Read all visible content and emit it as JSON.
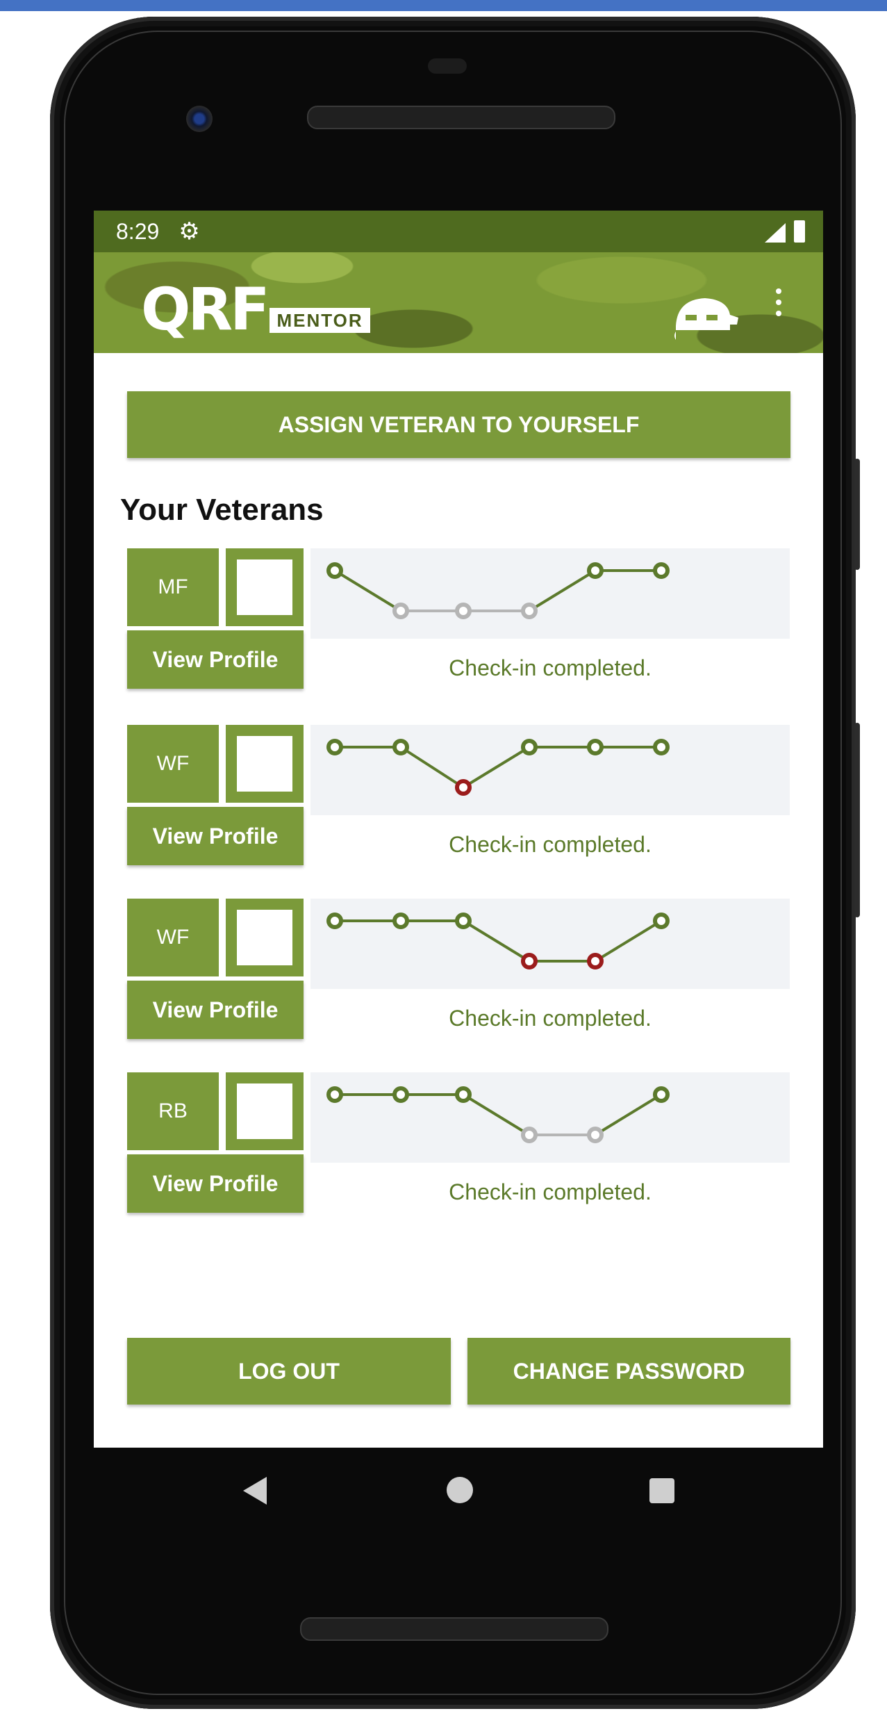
{
  "status_bar": {
    "time": "8:29",
    "gear_icon": "⚙"
  },
  "app_bar": {
    "logo_main": "QRF",
    "logo_sub": "MENTOR"
  },
  "assign_button": "ASSIGN VETERAN TO YOURSELF",
  "section_title": "Your Veterans",
  "veterans": [
    {
      "initials": "MF",
      "view_profile": "View Profile",
      "status": "Check-in completed.",
      "trend": [
        2,
        1,
        1,
        1,
        2,
        2
      ],
      "point_states": [
        "good",
        "neutral",
        "neutral",
        "neutral",
        "good",
        "good"
      ]
    },
    {
      "initials": "WF",
      "view_profile": "View Profile",
      "status": "Check-in completed.",
      "trend": [
        2,
        2,
        1,
        2,
        2,
        2
      ],
      "point_states": [
        "good",
        "good",
        "bad",
        "good",
        "good",
        "good"
      ]
    },
    {
      "initials": "WF",
      "view_profile": "View Profile",
      "status": "Check-in completed.",
      "trend": [
        2,
        2,
        2,
        1,
        1,
        2
      ],
      "point_states": [
        "good",
        "good",
        "good",
        "bad",
        "bad",
        "good"
      ]
    },
    {
      "initials": "RB",
      "view_profile": "View Profile",
      "status": "Check-in completed.",
      "trend": [
        2,
        2,
        2,
        1,
        1,
        2
      ],
      "point_states": [
        "good",
        "good",
        "good",
        "neutral",
        "neutral",
        "good"
      ]
    }
  ],
  "footer": {
    "logout": "LOG OUT",
    "change_password": "CHANGE PASSWORD"
  },
  "colors": {
    "accent": "#7b9a3a",
    "status_bar": "#4f6b1f",
    "point_good": "#5c7a2c",
    "point_bad": "#9b1c1c",
    "point_neutral": "#b5b5b5"
  }
}
